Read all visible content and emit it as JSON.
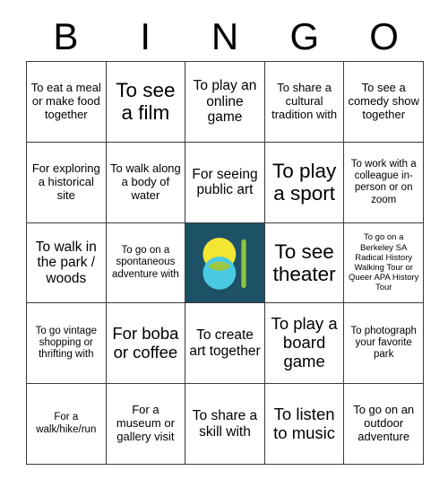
{
  "card": {
    "header_letters": [
      "B",
      "I",
      "N",
      "G",
      "O"
    ],
    "rows": [
      [
        {
          "text": "To eat a meal or make food together",
          "size": "sm"
        },
        {
          "text": "To see a film",
          "size": "xl"
        },
        {
          "text": "To play an online game",
          "size": "md"
        },
        {
          "text": "To share a cultural tradition with",
          "size": "sm"
        },
        {
          "text": "To see a comedy show together",
          "size": "sm"
        }
      ],
      [
        {
          "text": "For exploring a historical site",
          "size": "sm"
        },
        {
          "text": "To walk along a body of water",
          "size": "sm"
        },
        {
          "text": "For seeing public art",
          "size": "md"
        },
        {
          "text": "To play a sport",
          "size": "xl"
        },
        {
          "text": "To work with a colleague in-person or on zoom",
          "size": "xs"
        }
      ],
      [
        {
          "text": "To walk in the park / woods",
          "size": "md"
        },
        {
          "text": "To go on a spontaneous adventure with",
          "size": "xs"
        },
        {
          "text": "",
          "size": "sm",
          "free_space": true,
          "icon": "bingo-free-space-logo"
        },
        {
          "text": "To see theater",
          "size": "xl"
        },
        {
          "text": "To go on a Berkeley SA Radical History Walking Tour or Queer APA History Tour",
          "size": "xxs"
        }
      ],
      [
        {
          "text": "To go vintage shopping or thrifting with",
          "size": "xs"
        },
        {
          "text": "For boba or coffee",
          "size": "lg"
        },
        {
          "text": "To create art together",
          "size": "md"
        },
        {
          "text": "To play a board game",
          "size": "lg"
        },
        {
          "text": "To photograph your favorite park",
          "size": "xs"
        }
      ],
      [
        {
          "text": "For a walk/hike/run",
          "size": "xs"
        },
        {
          "text": "For a museum or gallery visit",
          "size": "sm"
        },
        {
          "text": "To share a skill with",
          "size": "md"
        },
        {
          "text": "To listen to music",
          "size": "lg"
        },
        {
          "text": "To go on an outdoor adventure",
          "size": "sm"
        }
      ]
    ]
  },
  "colors": {
    "free_space_background": "#1d5266",
    "logo_circle_top": "#f2e633",
    "logo_circle_bottom": "#4ac9e3",
    "logo_overlap": "#9dc93f",
    "logo_bar": "#8dc63f",
    "grid_line": "#3a3a3a",
    "text": "#000000",
    "page_background": "#ffffff"
  }
}
